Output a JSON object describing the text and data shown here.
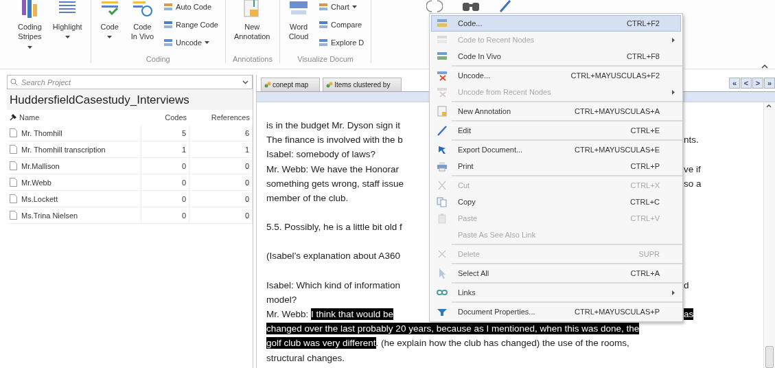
{
  "ribbon": {
    "groups": [
      {
        "buttons": [
          {
            "kind": "large",
            "label": "Coding\nStripes",
            "dropdown": true
          },
          {
            "kind": "large",
            "label": "Highlight",
            "dropdown": true
          }
        ]
      },
      {
        "label": "Coding",
        "buttons": [
          {
            "kind": "large",
            "label": "Code",
            "dropdown": true
          },
          {
            "kind": "large",
            "label": "Code\nIn Vivo",
            "dropdown": false
          },
          {
            "kind": "small",
            "label": "Auto Code",
            "dropdown": false
          },
          {
            "kind": "small",
            "label": "Range Code",
            "dropdown": false
          },
          {
            "kind": "small",
            "label": "Uncode",
            "dropdown": true
          }
        ]
      },
      {
        "label": "Annotations",
        "buttons": [
          {
            "kind": "large",
            "label": "New\nAnnotation",
            "dropdown": false
          }
        ]
      },
      {
        "label": "Visualize Docum",
        "buttons": [
          {
            "kind": "large",
            "label": "Word\nCloud",
            "dropdown": false
          },
          {
            "kind": "small",
            "label": "Chart",
            "dropdown": true
          },
          {
            "kind": "small",
            "label": "Compare",
            "dropdown": false
          },
          {
            "kind": "small",
            "label": "Explore D",
            "dropdown": false
          }
        ]
      }
    ]
  },
  "project_panel": {
    "search": {
      "placeholder": "Search Project"
    },
    "title": "HuddersfieldCasestudy_Interviews",
    "columns": [
      "Name",
      "Codes",
      "References"
    ],
    "rows": [
      {
        "name": "Mr. Thomhill",
        "codes": "5",
        "references": "6"
      },
      {
        "name": "Mr. Thomhill transcription",
        "codes": "1",
        "references": "1"
      },
      {
        "name": "Mr.Mallison",
        "codes": "0",
        "references": "0"
      },
      {
        "name": "Mr.Webb",
        "codes": "0",
        "references": "0"
      },
      {
        "name": "Ms.Lockett",
        "codes": "0",
        "references": "0"
      },
      {
        "name": "Ms.Trina Nielsen",
        "codes": "0",
        "references": "0"
      }
    ]
  },
  "document_tabs": [
    {
      "label": "conept map"
    },
    {
      "label": "Items clustered by"
    }
  ],
  "nav_buttons": [
    "«",
    "<",
    ">",
    "»"
  ],
  "document": {
    "paragraphs": [
      {
        "lines": [
          {
            "left": [
              {
                "text": "is in the budget Mr. Dyson sign it",
                "highlighted": false
              }
            ]
          },
          {
            "left": [
              {
                "text": "The finance is involved with the b",
                "highlighted": false
              }
            ],
            "right": [
              {
                "text": "nts.",
                "highlighted": false
              }
            ]
          },
          {
            "left": [
              {
                "text": "Isabel: somebody of laws?",
                "highlighted": false
              }
            ]
          },
          {
            "left": [
              {
                "text": "Mr. Webb: We have the Honorar",
                "highlighted": false
              }
            ],
            "right": [
              {
                "text": "ve if",
                "highlighted": false
              }
            ]
          },
          {
            "left": [
              {
                "text": "something gets wrong, staff issue",
                "highlighted": false
              }
            ],
            "right": [
              {
                "text": "so a",
                "highlighted": false
              }
            ]
          },
          {
            "left": [
              {
                "text": "member of the club.",
                "highlighted": false
              }
            ]
          }
        ]
      },
      {
        "lines": [
          {
            "left": [
              {
                "text": "5.5. Possibly, he is a little bit old f",
                "highlighted": false
              }
            ]
          }
        ]
      },
      {
        "lines": [
          {
            "left": [
              {
                "text": "(Isabel’s explanation about A360",
                "highlighted": false
              }
            ]
          }
        ]
      },
      {
        "lines": [
          {
            "left": [
              {
                "text": "Isabel: Which kind of information",
                "highlighted": false
              }
            ],
            "right": [
              {
                "text": "d",
                "highlighted": false
              }
            ]
          },
          {
            "left": [
              {
                "text": "model?",
                "highlighted": false
              }
            ]
          },
          {
            "left": [
              {
                "text": "Mr. Webb: ",
                "highlighted": false
              },
              {
                "text": "I think that would be",
                "highlighted": true
              }
            ],
            "right": [
              {
                "text": "as",
                "highlighted": true
              }
            ]
          },
          {
            "full": [
              {
                "text": "changed over the last probably 20 years, because as I mentioned, when this was done, the",
                "highlighted": true
              }
            ]
          },
          {
            "full": [
              {
                "text": "golf club was very different",
                "highlighted": true
              },
              {
                "text": ". (he explain how the club has changed) the use of the rooms,",
                "highlighted": false
              }
            ]
          },
          {
            "full": [
              {
                "text": "structural changes.",
                "highlighted": false
              }
            ]
          }
        ]
      }
    ]
  },
  "context_menu": {
    "items": [
      {
        "label": "Code...",
        "shortcut": "CTRL+F2",
        "disabled": false,
        "selected": true,
        "submenu": false,
        "separator_before": false
      },
      {
        "label": "Code to Recent Nodes",
        "disabled": true,
        "selected": false,
        "submenu": true,
        "separator_before": false
      },
      {
        "label": "Code In Vivo",
        "shortcut": "CTRL+F8",
        "disabled": false,
        "selected": false,
        "submenu": false,
        "separator_before": false
      },
      {
        "label": "Uncode...",
        "shortcut": "CTRL+MAYUSCULAS+F2",
        "disabled": false,
        "selected": false,
        "submenu": false,
        "separator_before": true
      },
      {
        "label": "Uncode from Recent Nodes",
        "disabled": true,
        "selected": false,
        "submenu": true,
        "separator_before": false
      },
      {
        "label": "New Annotation",
        "shortcut": "CTRL+MAYUSCULAS+A",
        "disabled": false,
        "selected": false,
        "submenu": false,
        "separator_before": true
      },
      {
        "label": "Edit",
        "shortcut": "CTRL+E",
        "disabled": false,
        "selected": false,
        "submenu": false,
        "separator_before": true
      },
      {
        "label": "Export Document...",
        "shortcut": "CTRL+MAYUSCULAS+E",
        "disabled": false,
        "selected": false,
        "submenu": false,
        "separator_before": true
      },
      {
        "label": "Print",
        "shortcut": "CTRL+P",
        "disabled": false,
        "selected": false,
        "submenu": false,
        "separator_before": false
      },
      {
        "label": "Cut",
        "shortcut": "CTRL+X",
        "disabled": true,
        "selected": false,
        "submenu": false,
        "separator_before": true
      },
      {
        "label": "Copy",
        "shortcut": "CTRL+C",
        "disabled": false,
        "selected": false,
        "submenu": false,
        "separator_before": false
      },
      {
        "label": "Paste",
        "shortcut": "CTRL+V",
        "disabled": true,
        "selected": false,
        "submenu": false,
        "separator_before": false
      },
      {
        "label": "Paste As See Also Link",
        "disabled": true,
        "selected": false,
        "submenu": false,
        "separator_before": false
      },
      {
        "label": "Delete",
        "shortcut": "SUPR",
        "disabled": true,
        "selected": false,
        "submenu": false,
        "separator_before": true
      },
      {
        "label": "Select All",
        "shortcut": "CTRL+A",
        "disabled": false,
        "selected": false,
        "submenu": false,
        "separator_before": true
      },
      {
        "label": "Links",
        "disabled": false,
        "selected": false,
        "submenu": true,
        "separator_before": true
      },
      {
        "label": "Document Properties...",
        "shortcut": "CTRL+MAYUSCULAS+P",
        "disabled": false,
        "selected": false,
        "submenu": false,
        "separator_before": true
      }
    ]
  }
}
